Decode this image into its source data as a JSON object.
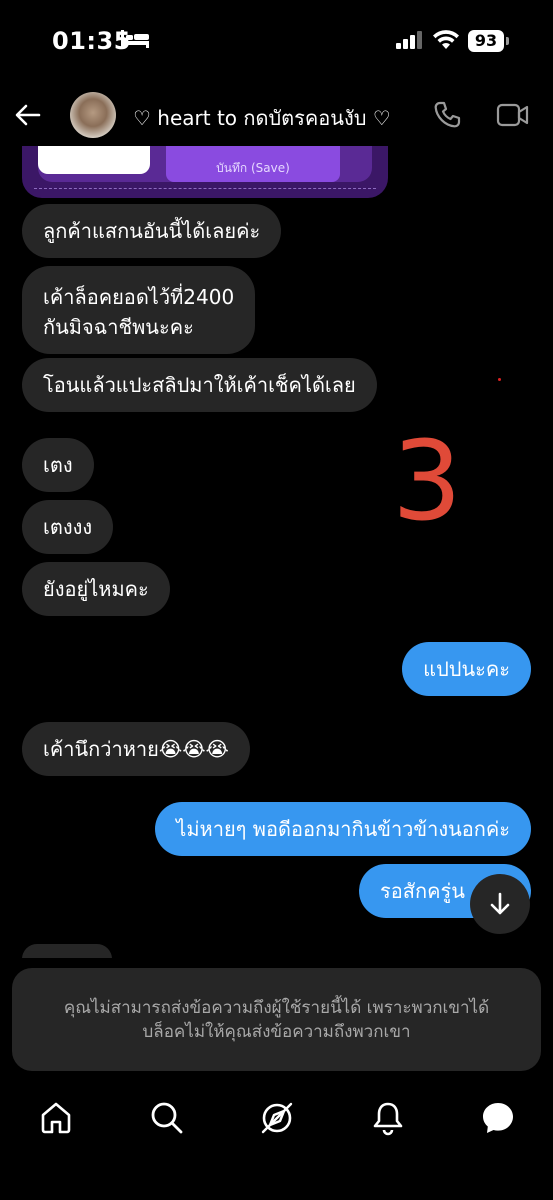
{
  "status_bar": {
    "time": "01:35",
    "battery": "93"
  },
  "header": {
    "title": "♡ heart to กดบัตรคอนงับ ♡"
  },
  "card": {
    "save_label": "บันทึก (Save)"
  },
  "messages": [
    {
      "dir": "in",
      "text": "ลูกค้าแสกนอันนี้ได้เลยค่ะ"
    },
    {
      "dir": "in",
      "text": "เค้าล็อคยอดไว้ที่2400"
    },
    {
      "dir": "in",
      "text": "กันมิจฉาชีพนะคะ"
    },
    {
      "dir": "in",
      "text": "โอนแล้วแปะสลิปมาให้เค้าเช็คได้เลย"
    },
    {
      "dir": "in",
      "text": "เตง"
    },
    {
      "dir": "in",
      "text": "เตงงง"
    },
    {
      "dir": "in",
      "text": "ยังอยู่ไหมคะ"
    },
    {
      "dir": "out",
      "text": "แปปนะคะ"
    },
    {
      "dir": "in",
      "text": "เค้านึกว่าหาย😭😭😭"
    },
    {
      "dir": "out",
      "text": "ไม่หายๆ พอดีออกมากินข้าวข้างนอกค่ะ"
    },
    {
      "dir": "out",
      "text": "รอสักครู่น"
    }
  ],
  "annotation": "3",
  "blocked_notice": {
    "line1": "คุณไม่สามารถส่งข้อความถึงผู้ใช้รายนี้ได้ เพราะพวกเขาได้",
    "line2": "บล็อคไม่ให้คุณส่งข้อความถึงพวกเขา"
  },
  "colors": {
    "outgoing": "#3797f0",
    "incoming": "#262626",
    "annotation": "#e04a38"
  },
  "tabs": [
    "home-icon",
    "search-icon",
    "explore-icon",
    "notifications-icon",
    "messages-icon"
  ]
}
